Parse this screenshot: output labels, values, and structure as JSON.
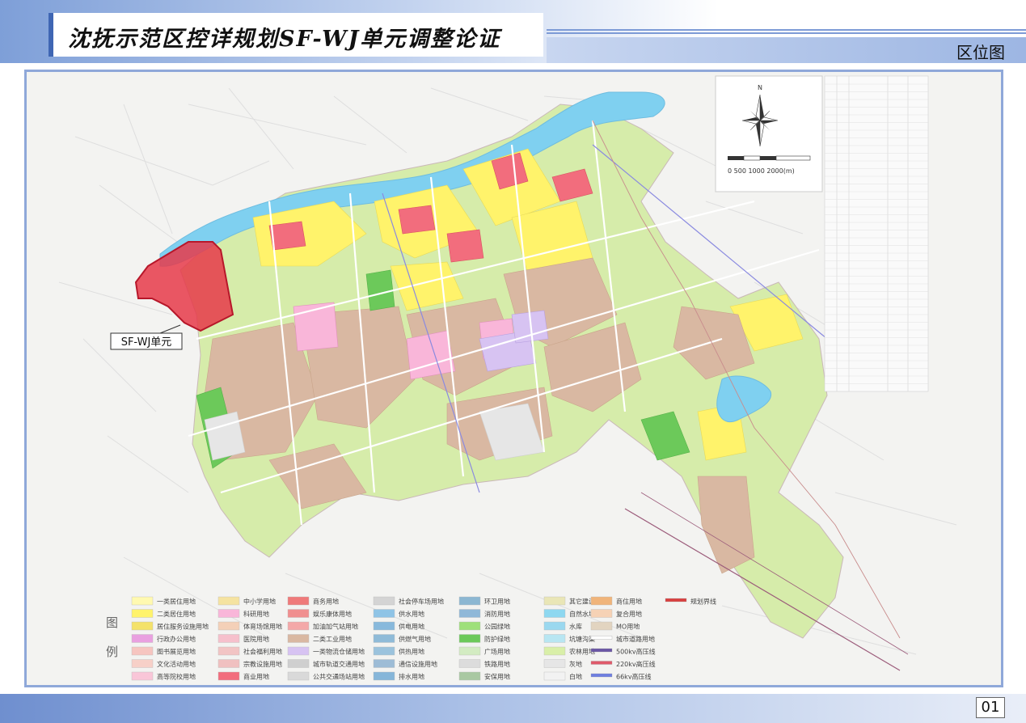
{
  "header": {
    "title": "沈抚示范区控详规划SF-WJ单元调整论证",
    "section": "区位图"
  },
  "footer": {
    "page": "01"
  },
  "map": {
    "unit_label": "SF-WJ单元",
    "north_label": "N",
    "scale_label": "0  500 1000    2000(m)",
    "highlight_color": "#e63a4a"
  },
  "legend": {
    "title_chars": [
      "图",
      "例"
    ],
    "items": [
      {
        "label": "一类居住用地",
        "color": "#fff9b0"
      },
      {
        "label": "二类居住用地",
        "color": "#fff36b"
      },
      {
        "label": "居住服务设施用地",
        "color": "#f4e26a"
      },
      {
        "label": "行政办公用地",
        "color": "#e9a0e0"
      },
      {
        "label": "图书展览用地",
        "color": "#f6c5c0"
      },
      {
        "label": "文化活动用地",
        "color": "#f7d0c8"
      },
      {
        "label": "高等院校用地",
        "color": "#f9c6d8"
      },
      {
        "label": "中小学用地",
        "color": "#f5e3a0"
      },
      {
        "label": "科研用地",
        "color": "#f9b6d9"
      },
      {
        "label": "体育场馆用地",
        "color": "#f4d0b8"
      },
      {
        "label": "医院用地",
        "color": "#f6c0cc"
      },
      {
        "label": "社会福利用地",
        "color": "#f2c4c4"
      },
      {
        "label": "宗教设施用地",
        "color": "#f0c0c0"
      },
      {
        "label": "商业用地",
        "color": "#f26d7d"
      },
      {
        "label": "商务用地",
        "color": "#ef7a7a"
      },
      {
        "label": "娱乐康体用地",
        "color": "#f08f8f"
      },
      {
        "label": "加油加气站用地",
        "color": "#f4a8a8"
      },
      {
        "label": "二类工业用地",
        "color": "#d9b8a2"
      },
      {
        "label": "一类物流仓储用地",
        "color": "#d7c3f2"
      },
      {
        "label": "城市轨道交通用地",
        "color": "#cfcfcf"
      },
      {
        "label": "公共交通场站用地",
        "color": "#d9d9d9"
      },
      {
        "label": "社会停车场用地",
        "color": "#d4d4d4"
      },
      {
        "label": "供水用地",
        "color": "#8fc4e6"
      },
      {
        "label": "供电用地",
        "color": "#88b9dc"
      },
      {
        "label": "供燃气用地",
        "color": "#8fbbd8"
      },
      {
        "label": "供热用地",
        "color": "#9bc3dd"
      },
      {
        "label": "通信设施用地",
        "color": "#9dbcd6"
      },
      {
        "label": "排水用地",
        "color": "#86b6d9"
      },
      {
        "label": "环卫用地",
        "color": "#8cb7d2"
      },
      {
        "label": "消防用地",
        "color": "#8fb8d8"
      },
      {
        "label": "公园绿地",
        "color": "#9ee07a"
      },
      {
        "label": "防护绿地",
        "color": "#6cc95a"
      },
      {
        "label": "广场用地",
        "color": "#d3ecc2"
      },
      {
        "label": "铁路用地",
        "color": "#dcdcdc"
      },
      {
        "label": "安保用地",
        "color": "#a9c8a2"
      },
      {
        "label": "其它建设用地",
        "color": "#e9e6b6"
      },
      {
        "label": "自然水域",
        "color": "#8ed8f0"
      },
      {
        "label": "水库",
        "color": "#9ad8ef"
      },
      {
        "label": "坑塘沟渠",
        "color": "#b8e6f2"
      },
      {
        "label": "农林用地",
        "color": "#d9efa8"
      },
      {
        "label": "灰地",
        "color": "#e6e6e6"
      },
      {
        "label": "白地",
        "color": "#f2f2f2"
      },
      {
        "label": "商住用地",
        "color": "#f0b47a"
      },
      {
        "label": "复合用地",
        "color": "#f6d2b5"
      },
      {
        "label": "MO用地",
        "color": "#e2d4c0"
      },
      {
        "label": "城市道路用地",
        "color": "#ffffff"
      },
      {
        "label": "500kv高压线",
        "color": "#6b57a5"
      },
      {
        "label": "220kv高压线",
        "color": "#e05a6a"
      },
      {
        "label": "66kv高压线",
        "color": "#6f7fe0"
      },
      {
        "label": "规划界线",
        "color": "#d94040"
      }
    ]
  }
}
